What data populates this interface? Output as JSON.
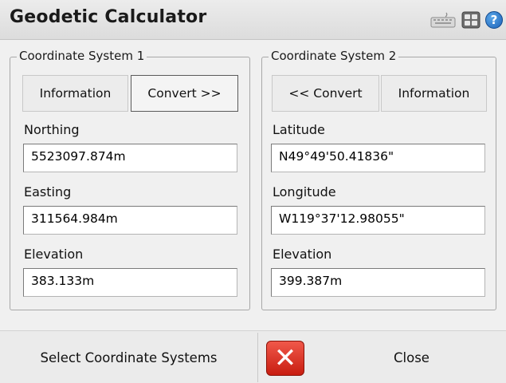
{
  "window": {
    "title": "Geodetic Calculator"
  },
  "toolbar_icons": [
    "keyboard-icon",
    "modules-icon",
    "help-icon"
  ],
  "help_glyph": "?",
  "group1": {
    "legend": "Coordinate System 1",
    "info_button": "Information",
    "convert_button": "Convert >>",
    "fields": [
      {
        "label": "Northing",
        "value": "5523097.874m"
      },
      {
        "label": "Easting",
        "value": "311564.984m"
      },
      {
        "label": "Elevation",
        "value": "383.133m"
      }
    ]
  },
  "group2": {
    "legend": "Coordinate System 2",
    "convert_button": "<< Convert",
    "info_button": "Information",
    "fields": [
      {
        "label": "Latitude",
        "value": "N49°49'50.41836\""
      },
      {
        "label": "Longitude",
        "value": "W119°37'12.98055\""
      },
      {
        "label": "Elevation",
        "value": "399.387m"
      }
    ]
  },
  "bottom": {
    "select_systems": "Select Coordinate Systems",
    "close": "Close",
    "close_icon": "x-icon"
  },
  "colors": {
    "close_icon_red": "#d8271a",
    "help_blue": "#1b62b8"
  }
}
